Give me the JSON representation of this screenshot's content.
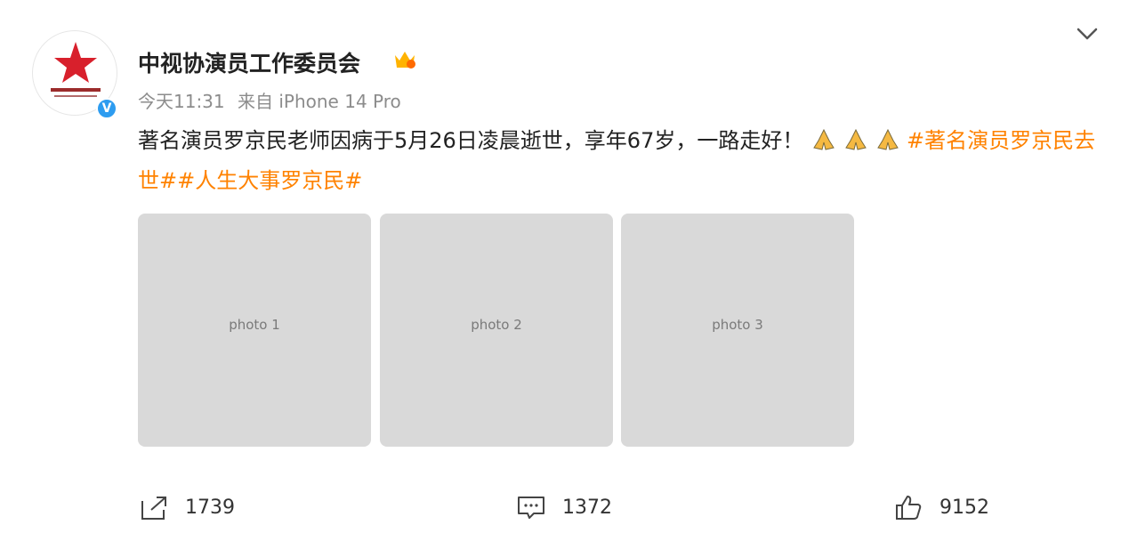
{
  "header": {
    "username": "中视协演员工作委员会",
    "time": "今天11:31",
    "source": "来自 iPhone 14 Pro",
    "verified_mark": "V"
  },
  "content": {
    "text": "著名演员罗京民老师因病于5月26日凌晨逝世，享年67岁，一路走好！",
    "emojis": [
      "pray-icon",
      "pray-icon",
      "pray-icon"
    ],
    "topic1": "#著名演员罗京民去世#",
    "topic2": "#人生大事罗京民#"
  },
  "photos": [
    {
      "label": "photo 1"
    },
    {
      "label": "photo 2"
    },
    {
      "label": "photo 3"
    }
  ],
  "actions": {
    "repost_count": "1739",
    "comment_count": "1372",
    "like_count": "9152"
  },
  "colors": {
    "topic": "#ff8200",
    "verified": "#2d9cf0"
  }
}
